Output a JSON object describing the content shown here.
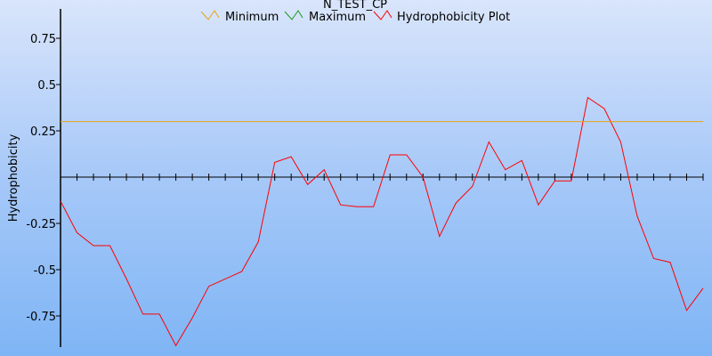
{
  "chart_data": {
    "type": "line",
    "title": "N_TEST_CP",
    "ylabel": "Hydrophobicity",
    "xlabel": "",
    "ylim": [
      -0.9,
      0.92
    ],
    "x_count": 40,
    "y_ticks": [
      {
        "value": 0.75,
        "label": "0.75"
      },
      {
        "value": 0.5,
        "label": "0.5"
      },
      {
        "value": 0.25,
        "label": "0.25"
      },
      {
        "value": -0.25,
        "label": "-0.25"
      },
      {
        "value": -0.5,
        "label": "-0.5"
      },
      {
        "value": -0.75,
        "label": "-0.75"
      }
    ],
    "legend": [
      {
        "name": "Minimum",
        "color": "#e8a317"
      },
      {
        "name": "Maximum",
        "color": "#1a9a1a"
      },
      {
        "name": "Hydrophobicity Plot",
        "color": "#ff0000"
      }
    ],
    "series": [
      {
        "name": "Hydrophobicity Plot",
        "color": "#ff0000",
        "values": [
          -0.13,
          -0.3,
          -0.37,
          -0.37,
          -0.55,
          -0.74,
          -0.74,
          -0.91,
          -0.76,
          -0.59,
          -0.55,
          -0.51,
          -0.35,
          0.08,
          0.11,
          -0.04,
          0.04,
          -0.15,
          -0.16,
          -0.16,
          0.12,
          0.12,
          0.0,
          -0.32,
          -0.14,
          -0.05,
          0.19,
          0.04,
          0.09,
          -0.15,
          -0.02,
          -0.02,
          0.43,
          0.37,
          0.19,
          -0.21,
          -0.44,
          -0.46,
          -0.72,
          -0.6
        ]
      },
      {
        "name": "Minimum",
        "color": "#e8a317",
        "values": [
          0.3
        ]
      }
    ]
  }
}
